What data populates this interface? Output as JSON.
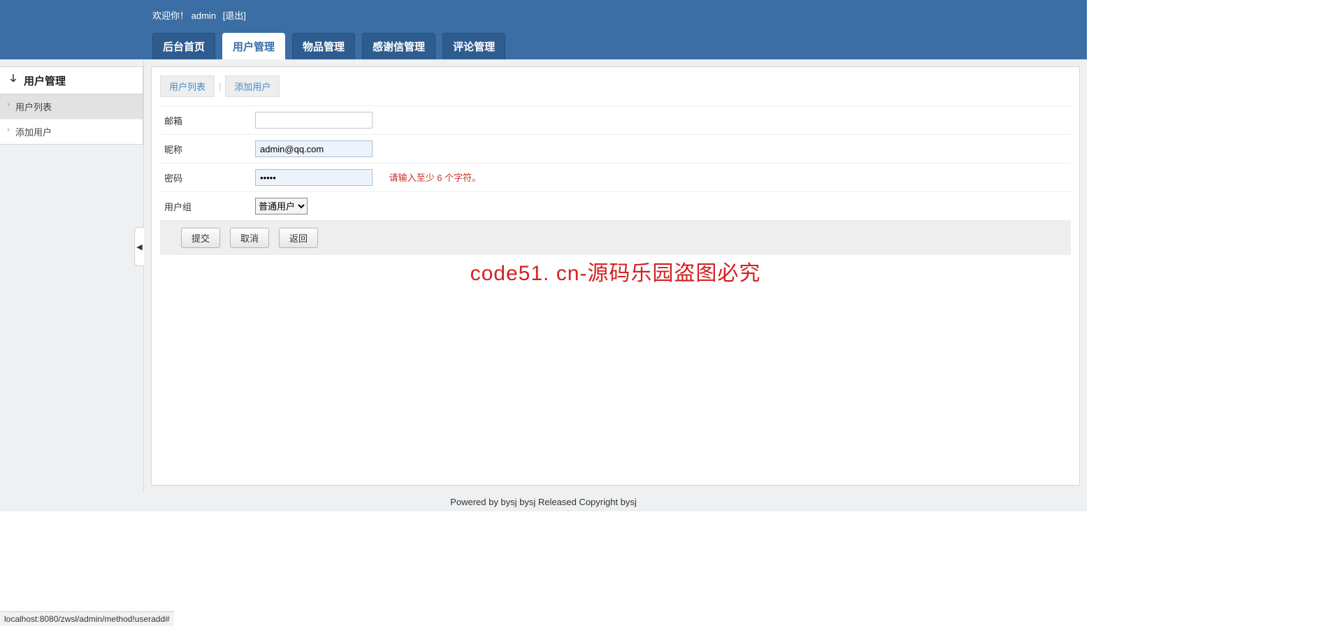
{
  "header": {
    "welcome_prefix": "欢迎你！",
    "username": "admin",
    "logout": "[退出]"
  },
  "nav": {
    "tabs": [
      {
        "label": "后台首页"
      },
      {
        "label": "用户管理"
      },
      {
        "label": "物品管理"
      },
      {
        "label": "感谢信管理"
      },
      {
        "label": "评论管理"
      }
    ],
    "active_index": 1
  },
  "sidebar": {
    "title": "用户管理",
    "items": [
      {
        "label": "用户列表"
      },
      {
        "label": "添加用户"
      }
    ],
    "active_index": 0,
    "collapse_glyph": "◀"
  },
  "subtabs": {
    "items": [
      {
        "label": "用户列表"
      },
      {
        "label": "添加用户"
      }
    ]
  },
  "form": {
    "email_label": "邮箱",
    "email_value": "",
    "nickname_label": "昵称",
    "nickname_value": "admin@qq.com",
    "password_label": "密码",
    "password_value": "•••••",
    "password_error": "请输入至少 6 个字符。",
    "group_label": "用户组",
    "group_options": [
      "普通用户"
    ],
    "group_selected": "普通用户",
    "submit_label": "提交",
    "cancel_label": "取消",
    "back_label": "返回"
  },
  "watermark": "code51. cn-源码乐园盗图必究",
  "footer": "Powered by bysj bysj Released  Copyright bysj",
  "statusbar": "localhost:8080/zwsl/admin/method!useradd#"
}
